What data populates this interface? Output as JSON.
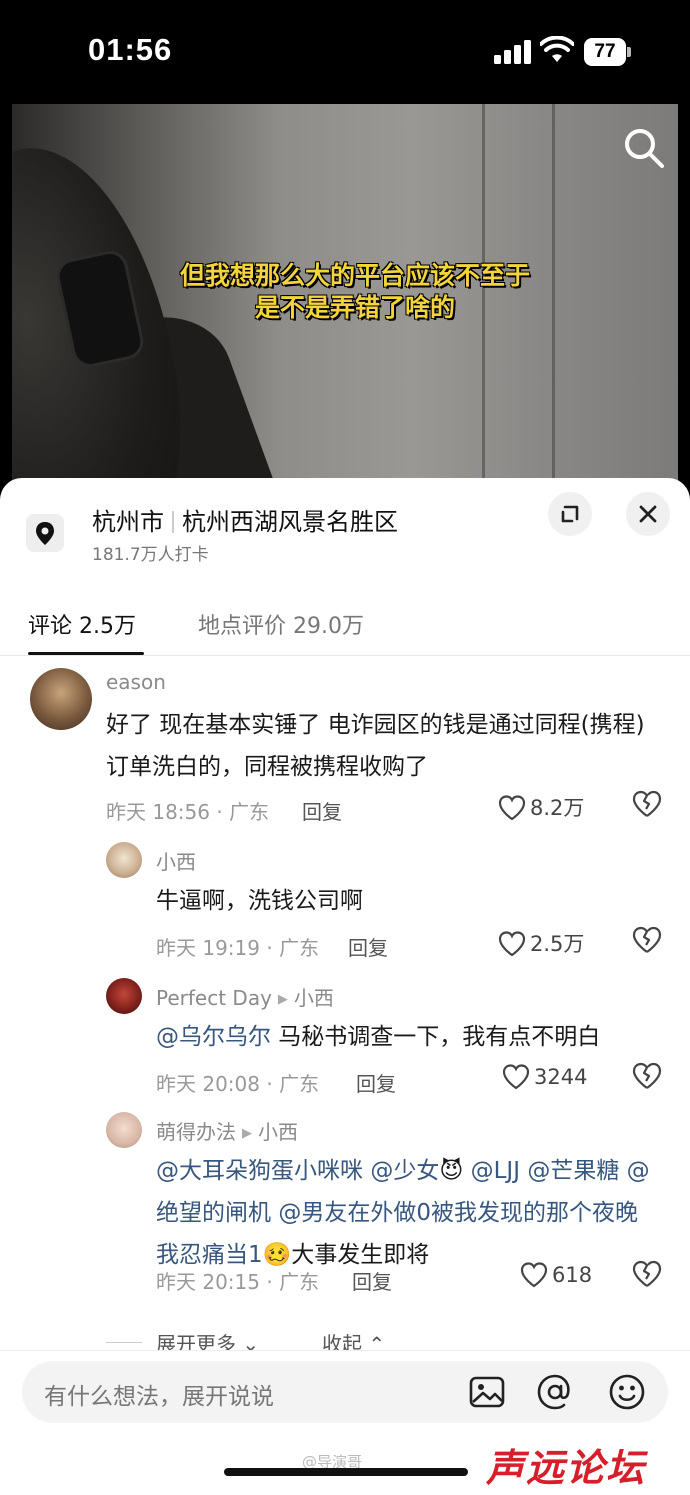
{
  "status_bar": {
    "time": "01:56",
    "battery": "77"
  },
  "video": {
    "subtitle_line1": "但我想那么大的平台应该不至于",
    "subtitle_line2": "是不是弄错了啥的"
  },
  "location": {
    "city": "杭州市",
    "place": "杭州西湖风景名胜区",
    "checkins": "181.7万人打卡"
  },
  "tabs": [
    {
      "label": "评论 2.5万",
      "active": true
    },
    {
      "label": "地点评价 29.0万",
      "active": false
    }
  ],
  "comments": [
    {
      "user": "eason",
      "text": "好了 现在基本实锤了 电诈园区的钱是通过同程(携程)订单洗白的，同程被携程收购了",
      "meta": "昨天 18:56 · 广东",
      "reply_label": "回复",
      "likes": "8.2万"
    },
    {
      "user": "小西",
      "text": "牛逼啊，洗钱公司啊",
      "meta": "昨天 19:19 · 广东",
      "reply_label": "回复",
      "likes": "2.5万"
    },
    {
      "user": "Perfect Day",
      "reply_to": "小西",
      "mention": "@乌尔乌尔",
      "text": " 马秘书调查一下，我有点不明白",
      "meta": "昨天 20:08 · 广东",
      "reply_label": "回复",
      "likes": "3244"
    },
    {
      "user": "萌得办法",
      "reply_to": "小西",
      "mentions": [
        "@大耳朵狗蛋小咪咪",
        "@少女",
        "@LJJ",
        "@芒果糖",
        "@绝望的闸机",
        "@男友在外做0被我发现的那个夜晚我忍痛当1"
      ],
      "text_tail": "大事发生即将",
      "emoji1": "😈",
      "emoji2": "🥴",
      "meta": "昨天 20:15 · 广东",
      "reply_label": "回复",
      "likes": "618"
    }
  ],
  "more": {
    "expand": "展开更多",
    "collapse": "收起"
  },
  "input": {
    "placeholder": "有什么想法，展开说说"
  },
  "watermark": {
    "handle": "@导演哥",
    "logo": "声远论坛"
  },
  "colors": {
    "mention": "#37577f",
    "subtitle": "#f3d43a",
    "logo": "#d61f2b"
  }
}
